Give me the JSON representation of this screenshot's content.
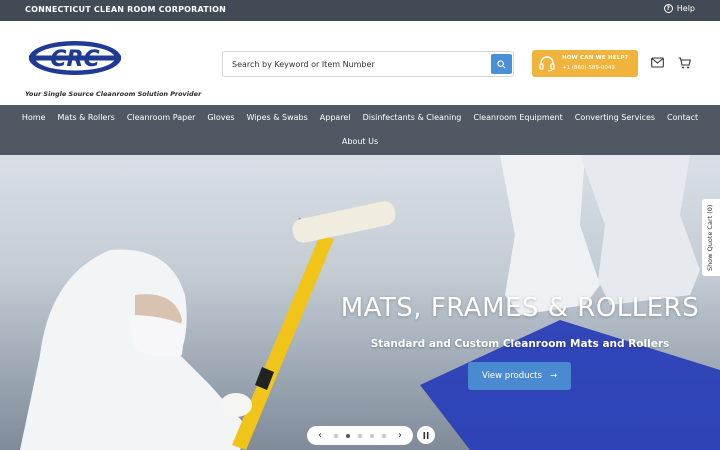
{
  "topbar": {
    "company": "CONNECTICUT CLEAN ROOM CORPORATION",
    "help": "Help"
  },
  "header": {
    "tagline": "Your Single Source Cleanroom Solution Provider",
    "search_placeholder": "Search by Keyword or Item Number",
    "callbox": {
      "title": "HOW CAN WE HELP?",
      "phone": "+1 (860) 589-0049"
    }
  },
  "nav": {
    "row1": [
      "Home",
      "Mats & Rollers",
      "Cleanroom Paper",
      "Gloves",
      "Wipes & Swabs",
      "Apparel",
      "Disinfectants & Cleaning",
      "Cleanroom Equipment",
      "Converting Services",
      "Contact"
    ],
    "row2": [
      "About Us"
    ]
  },
  "hero": {
    "title": "MATS, FRAMES & ROLLERS",
    "subtitle": "Standard and Custom Cleanroom Mats and Rollers",
    "cta": "View products",
    "slides_total": 5,
    "active_slide": 2
  },
  "quote_tab": "Show Quote Cart (0)",
  "colors": {
    "topbar": "#414a55",
    "nav": "#4f5863",
    "accent_blue": "#4a8ad1",
    "callbox": "#f0b43c",
    "logo_blue": "#1f3a93"
  }
}
